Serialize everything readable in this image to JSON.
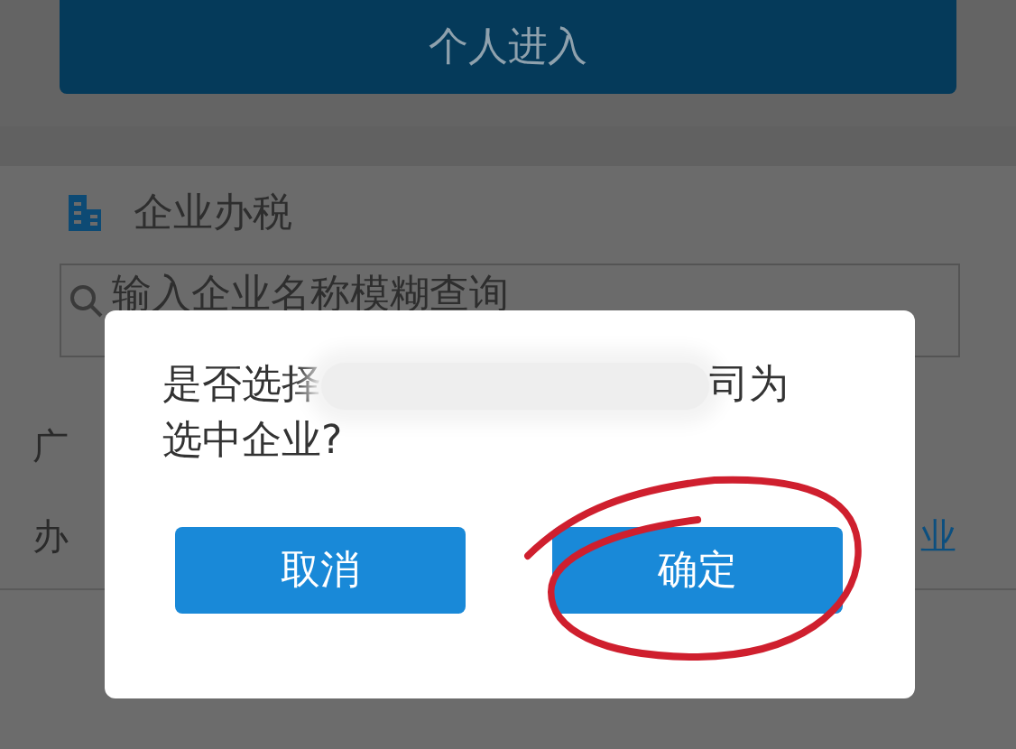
{
  "background": {
    "personal_button": "个人进入",
    "section_title": "企业办税",
    "search": {
      "placeholder": "输入企业名称模糊查询"
    },
    "rows": [
      {
        "text": "广"
      },
      {
        "text": "办",
        "link": "业"
      }
    ]
  },
  "dialog": {
    "message_start": "是否选择",
    "message_end": "司为",
    "message_line2": "选中企业?",
    "buttons": [
      {
        "label": "取消"
      },
      {
        "label": "确定"
      }
    ]
  }
}
